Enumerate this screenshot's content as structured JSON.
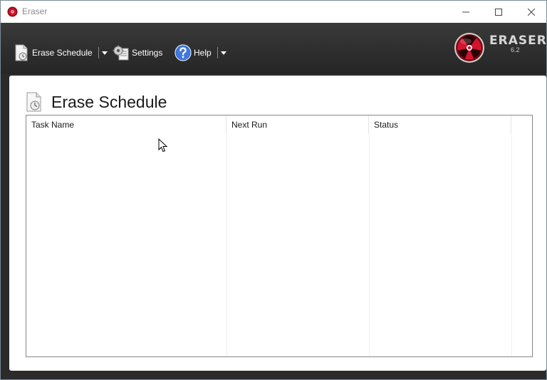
{
  "window": {
    "title": "Eraser",
    "minimize_glyph": "─",
    "maximize_glyph": "☐",
    "close_glyph": "✕"
  },
  "toolbar": {
    "erase_schedule_label": "Erase Schedule",
    "settings_label": "Settings",
    "help_label": "Help"
  },
  "branding": {
    "name": "ERASER",
    "version": "6.2"
  },
  "page": {
    "title": "Erase Schedule"
  },
  "task_list": {
    "columns": [
      "Task Name",
      "Next Run",
      "Status"
    ],
    "rows": []
  },
  "colors": {
    "toolbar_bg": "#2e2e2e",
    "logo_red": "#c8102e",
    "text_light": "#ffffff"
  }
}
